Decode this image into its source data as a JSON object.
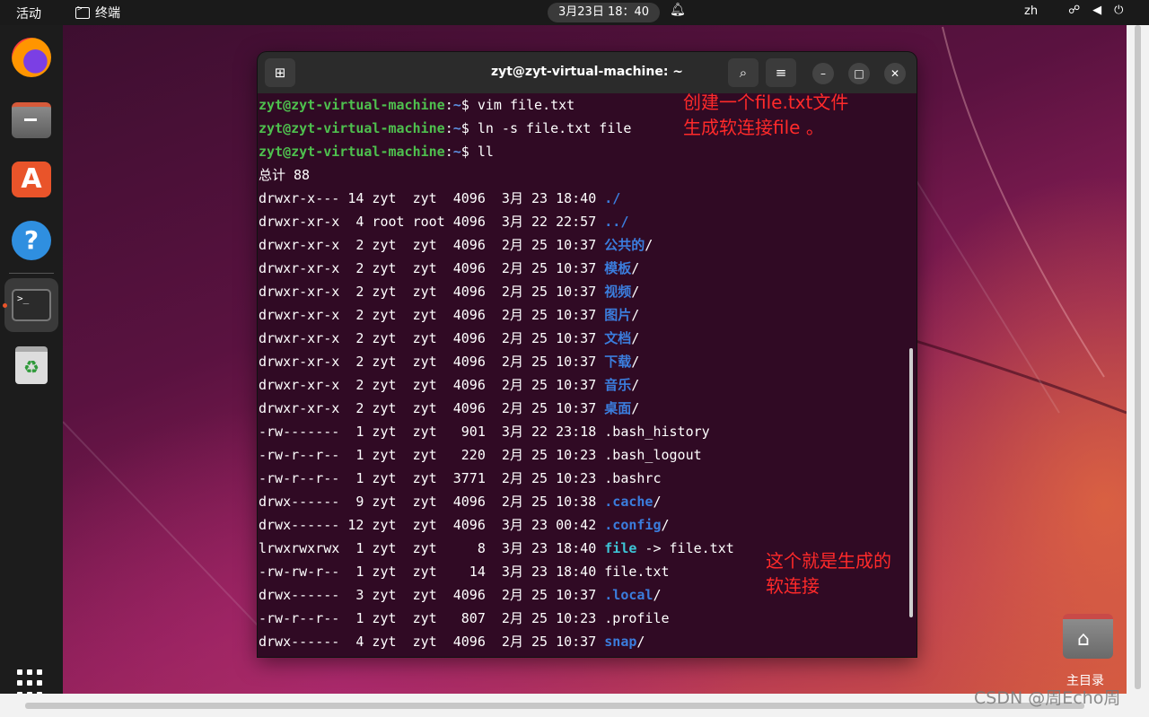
{
  "topbar": {
    "activities": "活动",
    "app_name": "终端",
    "clock": "3月23日  18：40",
    "lang": "zh",
    "tray_icons": [
      "network-icon",
      "volume-icon",
      "power-icon"
    ]
  },
  "dock": {
    "items": [
      "firefox",
      "files",
      "app-center",
      "help",
      "terminal",
      "trash",
      "show-apps"
    ]
  },
  "terminal": {
    "title": "zyt@zyt-virtual-machine: ~",
    "commands": [
      {
        "user": "zyt@zyt-virtual-machine",
        "path": "~",
        "cmd": " vim file.txt"
      },
      {
        "user": "zyt@zyt-virtual-machine",
        "path": "~",
        "cmd": " ln -s file.txt file"
      },
      {
        "user": "zyt@zyt-virtual-machine",
        "path": "~",
        "cmd": " ll"
      }
    ],
    "total": "总计 88",
    "listing": [
      {
        "meta": "drwxr-x--- 14 zyt  zyt  4096  3月 23 18:40 ",
        "name": "./",
        "type": "dir"
      },
      {
        "meta": "drwxr-xr-x  4 root root 4096  3月 22 22:57 ",
        "name": "../",
        "type": "dir"
      },
      {
        "meta": "drwxr-xr-x  2 zyt  zyt  4096  2月 25 10:37 ",
        "name": "公共的",
        "suffix": "/",
        "type": "dir"
      },
      {
        "meta": "drwxr-xr-x  2 zyt  zyt  4096  2月 25 10:37 ",
        "name": "模板",
        "suffix": "/",
        "type": "dir"
      },
      {
        "meta": "drwxr-xr-x  2 zyt  zyt  4096  2月 25 10:37 ",
        "name": "视频",
        "suffix": "/",
        "type": "dir"
      },
      {
        "meta": "drwxr-xr-x  2 zyt  zyt  4096  2月 25 10:37 ",
        "name": "图片",
        "suffix": "/",
        "type": "dir"
      },
      {
        "meta": "drwxr-xr-x  2 zyt  zyt  4096  2月 25 10:37 ",
        "name": "文档",
        "suffix": "/",
        "type": "dir"
      },
      {
        "meta": "drwxr-xr-x  2 zyt  zyt  4096  2月 25 10:37 ",
        "name": "下载",
        "suffix": "/",
        "type": "dir"
      },
      {
        "meta": "drwxr-xr-x  2 zyt  zyt  4096  2月 25 10:37 ",
        "name": "音乐",
        "suffix": "/",
        "type": "dir"
      },
      {
        "meta": "drwxr-xr-x  2 zyt  zyt  4096  2月 25 10:37 ",
        "name": "桌面",
        "suffix": "/",
        "type": "dir"
      },
      {
        "meta": "-rw-------  1 zyt  zyt   901  3月 22 23:18 ",
        "name": ".bash_history",
        "type": "file"
      },
      {
        "meta": "-rw-r--r--  1 zyt  zyt   220  2月 25 10:23 ",
        "name": ".bash_logout",
        "type": "file"
      },
      {
        "meta": "-rw-r--r--  1 zyt  zyt  3771  2月 25 10:23 ",
        "name": ".bashrc",
        "type": "file"
      },
      {
        "meta": "drwx------  9 zyt  zyt  4096  2月 25 10:38 ",
        "name": ".cache",
        "suffix": "/",
        "type": "dir"
      },
      {
        "meta": "drwx------ 12 zyt  zyt  4096  3月 23 00:42 ",
        "name": ".config",
        "suffix": "/",
        "type": "dir"
      },
      {
        "meta": "lrwxrwxrwx  1 zyt  zyt     8  3月 23 18:40 ",
        "name": "file",
        "suffix": " -> file.txt",
        "type": "link"
      },
      {
        "meta": "-rw-rw-r--  1 zyt  zyt    14  3月 23 18:40 ",
        "name": "file.txt",
        "type": "file"
      },
      {
        "meta": "drwx------  3 zyt  zyt  4096  2月 25 10:37 ",
        "name": ".local",
        "suffix": "/",
        "type": "dir"
      },
      {
        "meta": "-rw-r--r--  1 zyt  zyt   807  2月 25 10:23 ",
        "name": ".profile",
        "type": "file"
      },
      {
        "meta": "drwx------  4 zyt  zyt  4096  2月 25 10:37 ",
        "name": "snap",
        "suffix": "/",
        "type": "dir"
      }
    ]
  },
  "annotations": {
    "note1": "创建一个file.txt文件\n生成软连接file 。",
    "note2": "这个就是生成的\n软连接"
  },
  "desktop": {
    "home_label": "主目录",
    "watermark": "CSDN @周Echo周"
  }
}
